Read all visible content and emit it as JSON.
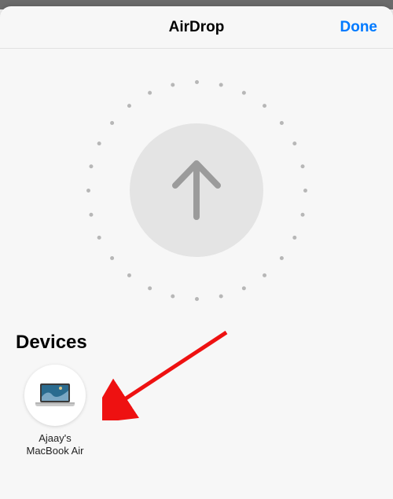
{
  "header": {
    "title": "AirDrop",
    "done_label": "Done"
  },
  "devices": {
    "heading": "Devices",
    "items": [
      {
        "label": "Ajaay's\nMacBook Air"
      }
    ]
  }
}
